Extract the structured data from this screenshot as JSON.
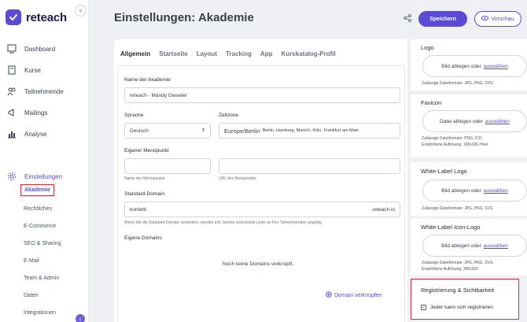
{
  "brand": {
    "name": "reteach"
  },
  "nav": {
    "items": [
      {
        "label": "Dashboard",
        "icon": "dashboard-icon"
      },
      {
        "label": "Kurse",
        "icon": "book-icon"
      },
      {
        "label": "Teilnehmende",
        "icon": "users-icon"
      },
      {
        "label": "Mailings",
        "icon": "megaphone-icon"
      },
      {
        "label": "Analyse",
        "icon": "chart-icon"
      }
    ],
    "settings": {
      "label": "Einstellungen",
      "icon": "gear-icon"
    },
    "sub_items": [
      "Akademie",
      "Rechtliches",
      "E-Commerce",
      "SEO & Sharing",
      "E-Mail",
      "Team & Admin",
      "Daten",
      "Integrationen"
    ],
    "active_sub": "Akademie"
  },
  "header": {
    "title": "Einstellungen: Akademie",
    "save_label": "Speichern",
    "preview_label": "Vorschau"
  },
  "tabs": [
    "Allgemein",
    "Startseite",
    "Layout",
    "Tracking",
    "App",
    "Kurskatalog-Profil"
  ],
  "form": {
    "academy_name_label": "Name der Akademie",
    "academy_name_value": "reteach - Mandy Gieseler",
    "language_label": "Sprache",
    "language_value": "Deutsch",
    "timezone_label": "Zeitzone",
    "timezone_value": "Europe/Berlin",
    "timezone_sub": " - Berlin, Hamburg, Munich, Köln, Frankfurt am Main",
    "menu_label": "Eigener Menüpunkt",
    "menu_name_hint": "Name des Menüpunkts",
    "menu_url_hint": "URL des Menüpunkts",
    "domain_label": "Standard-Domain",
    "domain_value": "konfetti",
    "domain_suffix": ".reteach.io",
    "domain_hint": "Wenn Sie die Standard-Domain verändern, werden evtl. bereits verschickte Links an Ihre Teilnehmenden ungültig.",
    "own_domains_label": "Eigene Domains",
    "no_domains": "Noch keine Domains verknüpft.",
    "link_domain": "Domain verknüpfen"
  },
  "right": {
    "logo": {
      "title": "Logo",
      "drop": "Bild ablegen oder",
      "link": "auswählen",
      "hint": "Zulässige Dateiformate: JPG, PNG, SVG"
    },
    "favicon": {
      "title": "Favicon",
      "drop": "Datei ablegen oder",
      "link": "auswählen",
      "hint": "Zulässige Dateiformate: PNG, ICO.",
      "hint2": "Empfohlene Auflösung: 196x196 Pixel"
    },
    "wl_logo": {
      "title": "White-Label Logo",
      "drop": "Bild ablegen oder",
      "link": "auswählen",
      "hint": "Zulässige Dateiformate: JPG, PNG, SVG"
    },
    "wl_icon": {
      "title": "White-Label Icon-Logo",
      "drop": "Bild ablegen oder",
      "link": "auswählen",
      "hint": "Zulässige Dateiformate: JPG, PNG, SVG",
      "hint2": "Empfohlene Auflösung: 300x300"
    },
    "registration": {
      "title": "Registrierung & Sichtbarkeit",
      "checkbox_label": "Jeder kann sich registrieren",
      "checked": true
    }
  },
  "colors": {
    "accent": "#5b4ad6",
    "highlight": "#d62d3a"
  }
}
